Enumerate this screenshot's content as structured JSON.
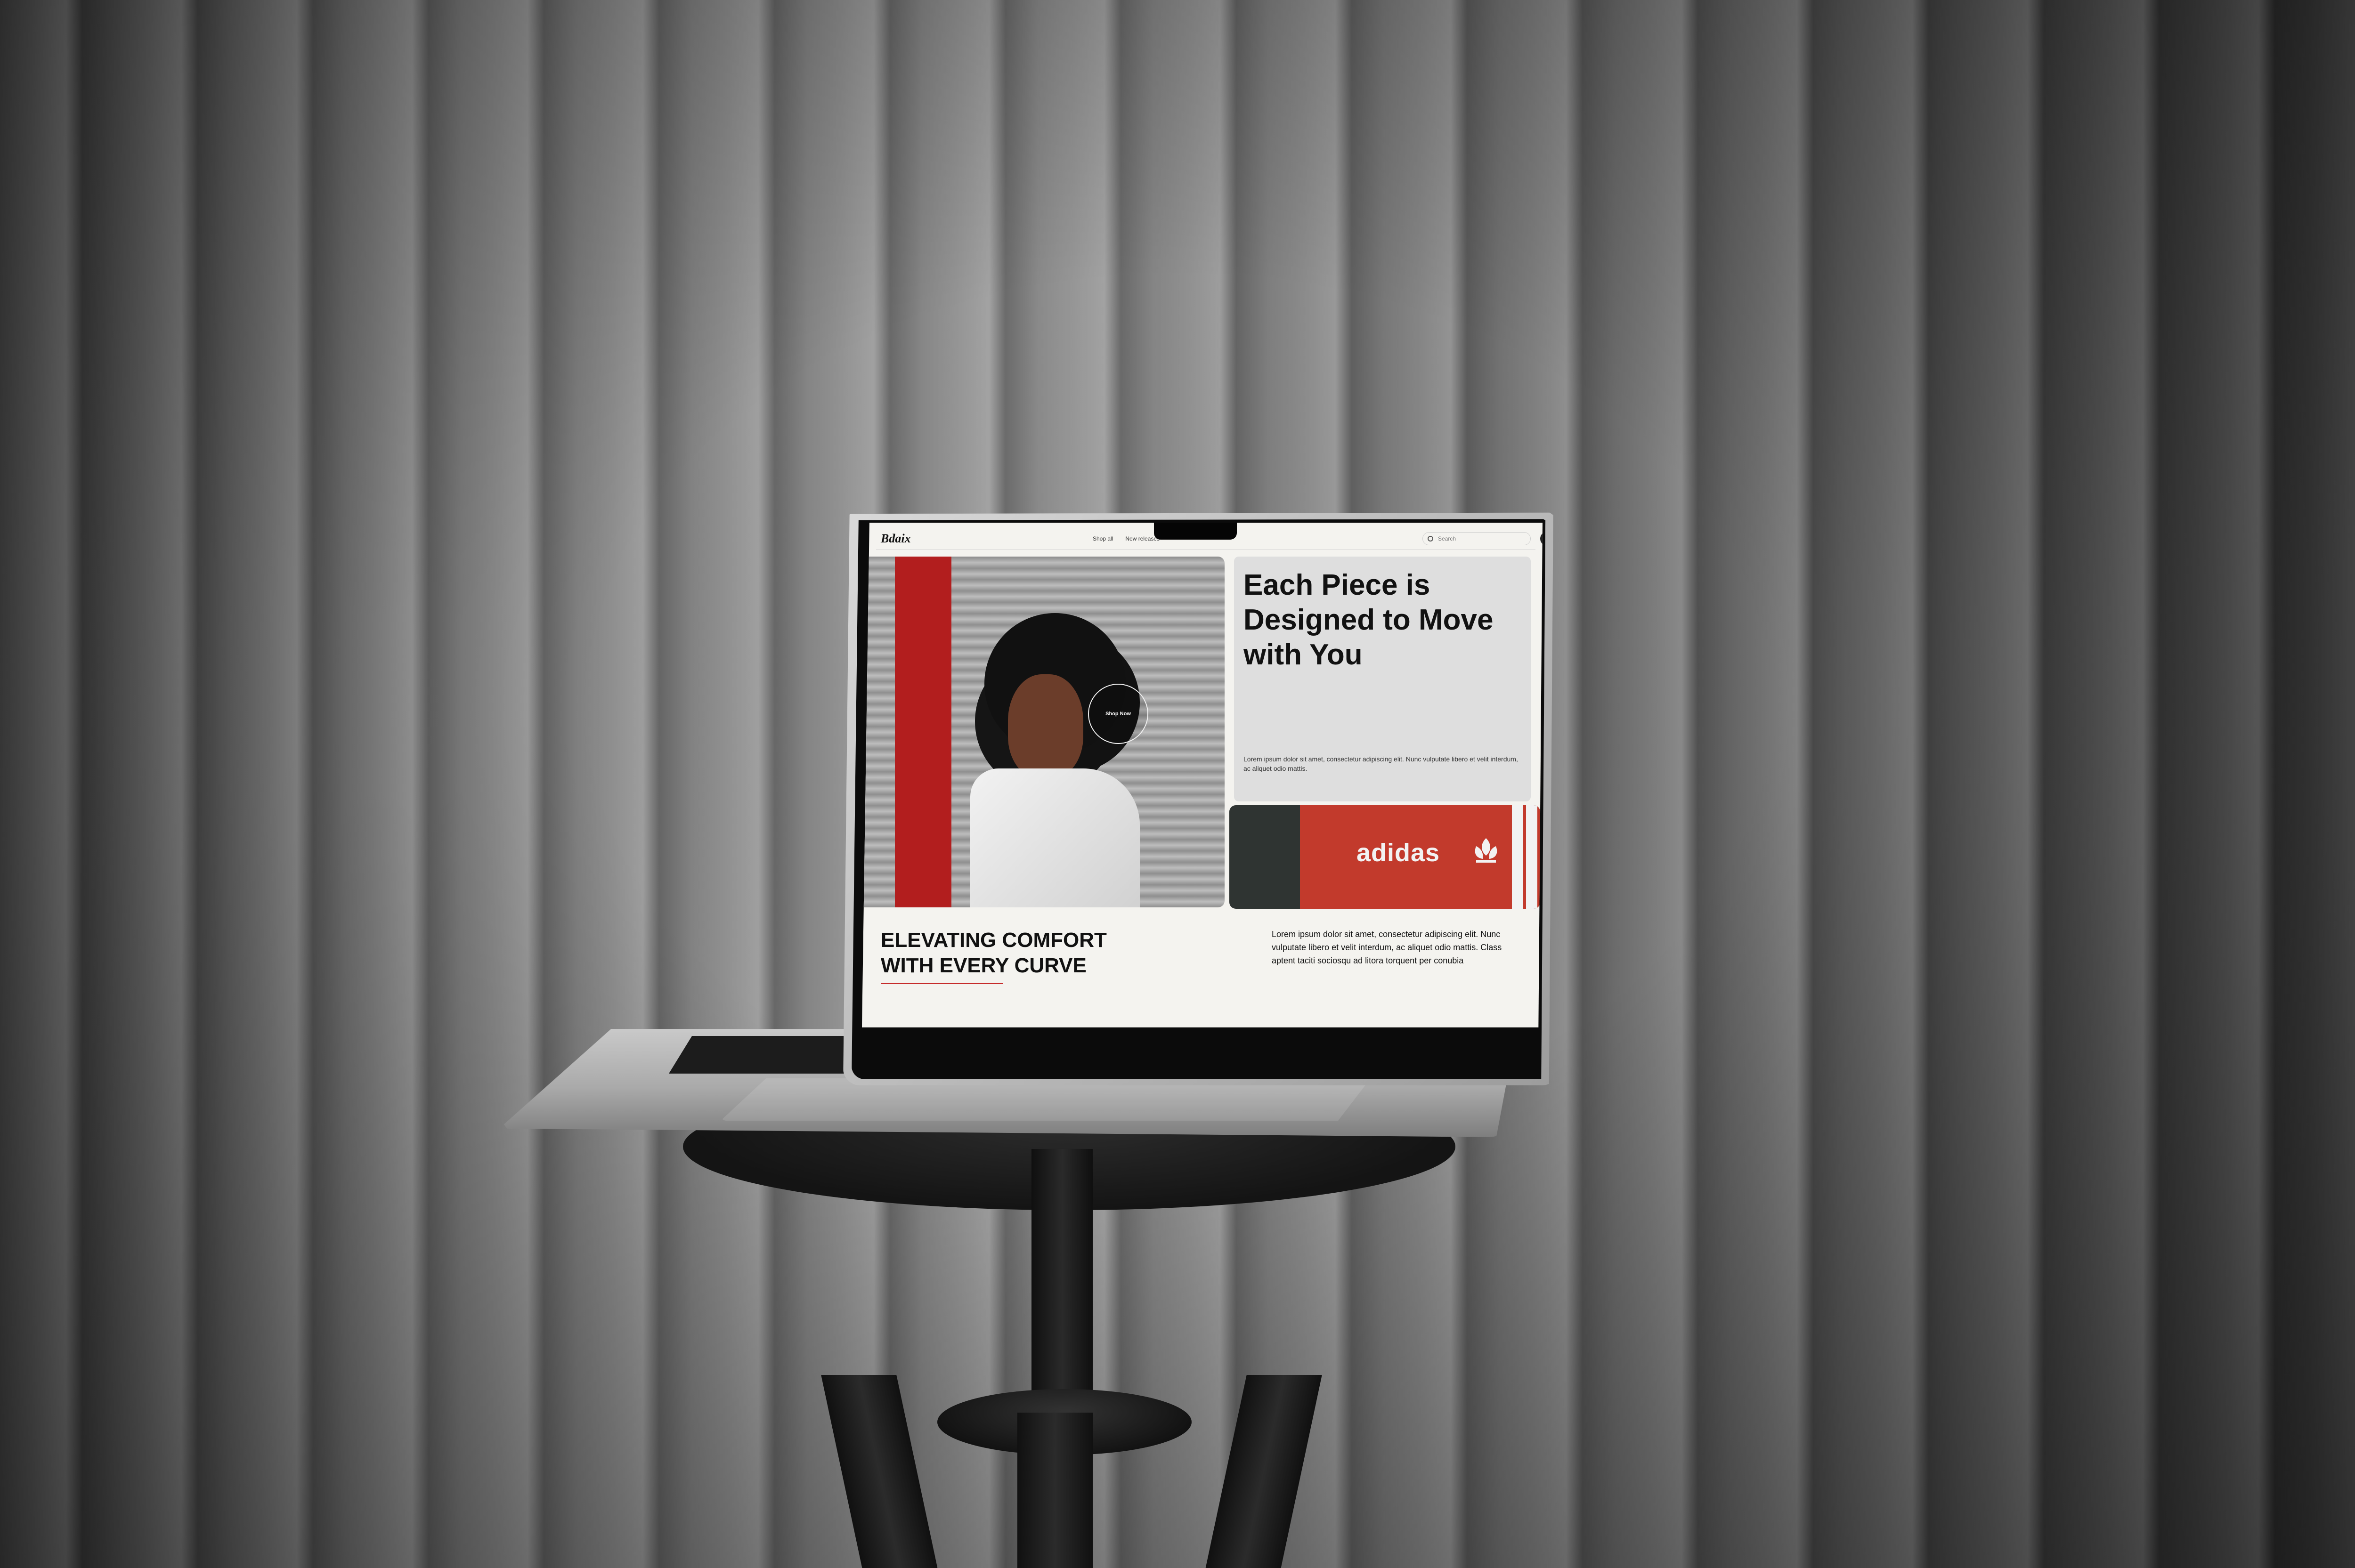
{
  "site": {
    "logo": "Bdaix",
    "nav": [
      "Shop all",
      "New releases"
    ],
    "search": {
      "placeholder": "Search"
    }
  },
  "hero": {
    "title": "Each Piece is Designed to Move with You",
    "shop_now": "Shop Now",
    "body": "Lorem ipsum dolor sit amet, consectetur adipiscing elit. Nunc vulputate libero et velit interdum, ac aliquet odio mattis."
  },
  "product": {
    "brand": "adidas"
  },
  "section": {
    "title_line1": "ELEVATING COMFORT",
    "title_line2": "WITH EVERY CURVE",
    "body": "Lorem ipsum dolor sit amet, consectetur adipiscing elit. Nunc vulputate libero et velit interdum, ac aliquet odio mattis. Class aptent taciti sociosqu ad litora torquent per conubia"
  },
  "colors": {
    "accent_red": "#c23a2c",
    "background": "#f4f3ef",
    "text": "#111111"
  },
  "icons": {
    "search": "search-icon",
    "avatar": "avatar",
    "trefoil": "trefoil-icon"
  }
}
